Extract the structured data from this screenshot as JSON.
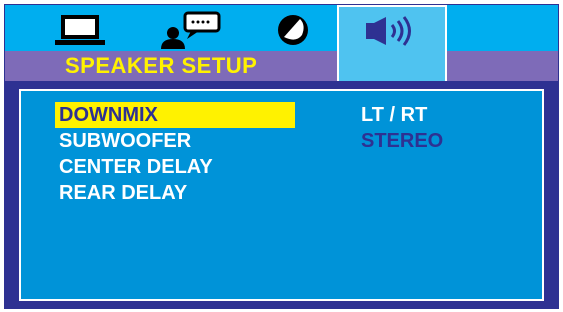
{
  "tabs": [
    {
      "name": "general-setup",
      "icon": "monitor-icon"
    },
    {
      "name": "language-setup",
      "icon": "speech-person-icon"
    },
    {
      "name": "video-setup",
      "icon": "disc-icon"
    },
    {
      "name": "speaker-setup",
      "icon": "speaker-icon",
      "selected": true
    }
  ],
  "page": {
    "title": "SPEAKER SETUP"
  },
  "menu": {
    "items": [
      {
        "label": "DOWNMIX",
        "selected": true
      },
      {
        "label": "SUBWOOFER"
      },
      {
        "label": "CENTER DELAY"
      },
      {
        "label": "REAR DELAY"
      }
    ]
  },
  "options": {
    "items": [
      {
        "label": "LT / RT",
        "state": "highlighted"
      },
      {
        "label": "STEREO",
        "state": "normal"
      }
    ]
  },
  "colors": {
    "background": "#00aeef",
    "title_bar": "#7e6bb8",
    "panel": "#0093d8",
    "selection": "#fff200",
    "dark_text": "#2e3192"
  }
}
